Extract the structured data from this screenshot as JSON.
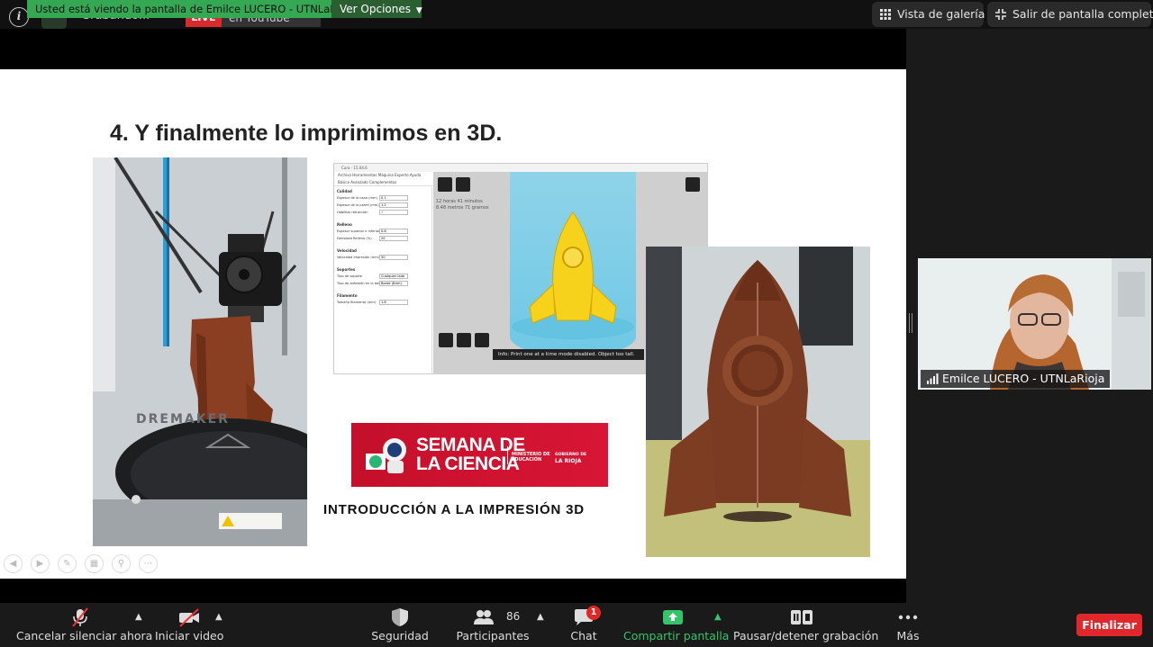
{
  "app": {
    "recording_status": "Grabando...",
    "live_label": "LIVE",
    "stream_label": "en YouTube",
    "share_banner": "Usted está viendo la pantalla de Emilce LUCERO - UTNLaRioja",
    "view_options_label": "Ver Opciones",
    "gallery_view_label": "Vista de galería",
    "exit_fullscreen_label": "Salir de pantalla completa"
  },
  "slide": {
    "title": "4. Y finalmente lo imprimimos en 3D.",
    "intro_text": "INTRODUCCIÓN A LA IMPRESIÓN 3D",
    "banner": {
      "line1": "SEMANA DE",
      "line2": "LA CIENCIA",
      "ministry_line1": "MINISTERIO DE",
      "ministry_line2": "EDUCACIÓN",
      "gov_line1": "GOBIERNO DE",
      "gov_line2": "LA RIOJA"
    },
    "printer_base_text": "DREMAKER",
    "cura": {
      "window_title": "Cura - 15.04.6",
      "menu": "Archivo   Herramientas   Máquina   Experto   Ayuda",
      "tabs": "Básico   Avanzado   Complementos",
      "sections": [
        {
          "heading": "Calidad",
          "rows": [
            {
              "label": "Espesor de la capa (mm)",
              "value": "0.1"
            },
            {
              "label": "Espesor de la pared (mm)",
              "value": "1.2"
            },
            {
              "label": "Habilitar retracción",
              "value": "✓"
            }
          ]
        },
        {
          "heading": "Relleno",
          "rows": [
            {
              "label": "Espesor superior e inferior",
              "value": "0.6"
            },
            {
              "label": "Densidad Relleno (%)",
              "value": "20"
            }
          ]
        },
        {
          "heading": "Velocidad",
          "rows": [
            {
              "label": "Velocidad impresión (mm/s)",
              "value": "50"
            }
          ]
        },
        {
          "heading": "Soportes",
          "rows": [
            {
              "label": "Tipo de soporte",
              "value": "Cualquier lado"
            },
            {
              "label": "Tipo de adhesión en la base",
              "value": "Borde (Brim)"
            }
          ]
        },
        {
          "heading": "Filamento",
          "rows": [
            {
              "label": "Tamaño filamento (mm)",
              "value": "1.8"
            }
          ]
        }
      ],
      "stats_line1": "12 horas 41 minutos",
      "stats_line2": "8.48 metros 71 gramos",
      "info_text": "Info: Print one at a time mode disabled. Object too tall."
    }
  },
  "participant": {
    "name": "Emilce LUCERO - UTNLaRioja"
  },
  "toolbar": {
    "unmute_label": "Cancelar silenciar ahora",
    "video_label": "Iniciar video",
    "security_label": "Seguridad",
    "participants_label": "Participantes",
    "participants_count": "86",
    "chat_label": "Chat",
    "chat_badge": "1",
    "share_label": "Compartir pantalla",
    "pause_rec_label": "Pausar/detener grabación",
    "more_label": "Más",
    "end_label": "Finalizar"
  },
  "colors": {
    "share_banner": "#35a853",
    "share_green": "#35c46a",
    "end_button": "#e0272b",
    "semana_red": "#c4102a",
    "rocket_brown": "#7a3b22",
    "cura_yellow": "#f6d21d"
  },
  "icons": {
    "info": "info-icon",
    "gallery": "grid-icon",
    "exit_fullscreen": "collapse-icon",
    "mic_muted": "mic-off-icon",
    "video_off": "video-off-icon",
    "security": "shield-icon",
    "participants": "people-icon",
    "chat": "chat-bubble-icon",
    "share": "share-arrow-icon",
    "pause_rec": "pause-stop-icon",
    "more": "ellipsis-icon"
  }
}
